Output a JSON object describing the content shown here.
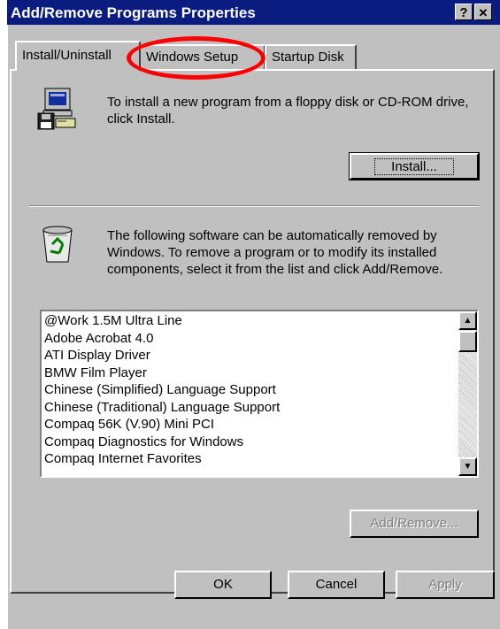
{
  "window": {
    "title": "Add/Remove Programs Properties",
    "help_glyph": "?",
    "close_glyph": "✕"
  },
  "tabs": [
    {
      "label": "Install/Uninstall",
      "active": true
    },
    {
      "label": "Windows Setup",
      "active": false,
      "highlighted": true
    },
    {
      "label": "Startup Disk",
      "active": false
    }
  ],
  "install_section": {
    "icon": "floppy-computer-icon",
    "text": "To install a new program from a floppy disk or CD-ROM drive, click Install.",
    "button_label": "Install..."
  },
  "uninstall_section": {
    "icon": "recycle-bin-icon",
    "text": "The following software can be automatically removed by Windows. To remove a program or to modify its installed components, select it from the list and click Add/Remove.",
    "programs": [
      "@Work 1.5M Ultra Line",
      "Adobe Acrobat 4.0",
      "ATI Display Driver",
      "BMW Film Player",
      "Chinese (Simplified) Language Support",
      "Chinese (Traditional) Language Support",
      "Compaq 56K (V.90) Mini PCI",
      "Compaq Diagnostics for Windows",
      "Compaq Internet Favorites"
    ],
    "add_remove_label": "Add/Remove..."
  },
  "footer": {
    "ok_label": "OK",
    "cancel_label": "Cancel",
    "apply_label": "Apply"
  },
  "colors": {
    "titlebar": "#0a1c7f",
    "dialog_face": "#c0c0c0",
    "highlight_ring": "#ff0000"
  }
}
